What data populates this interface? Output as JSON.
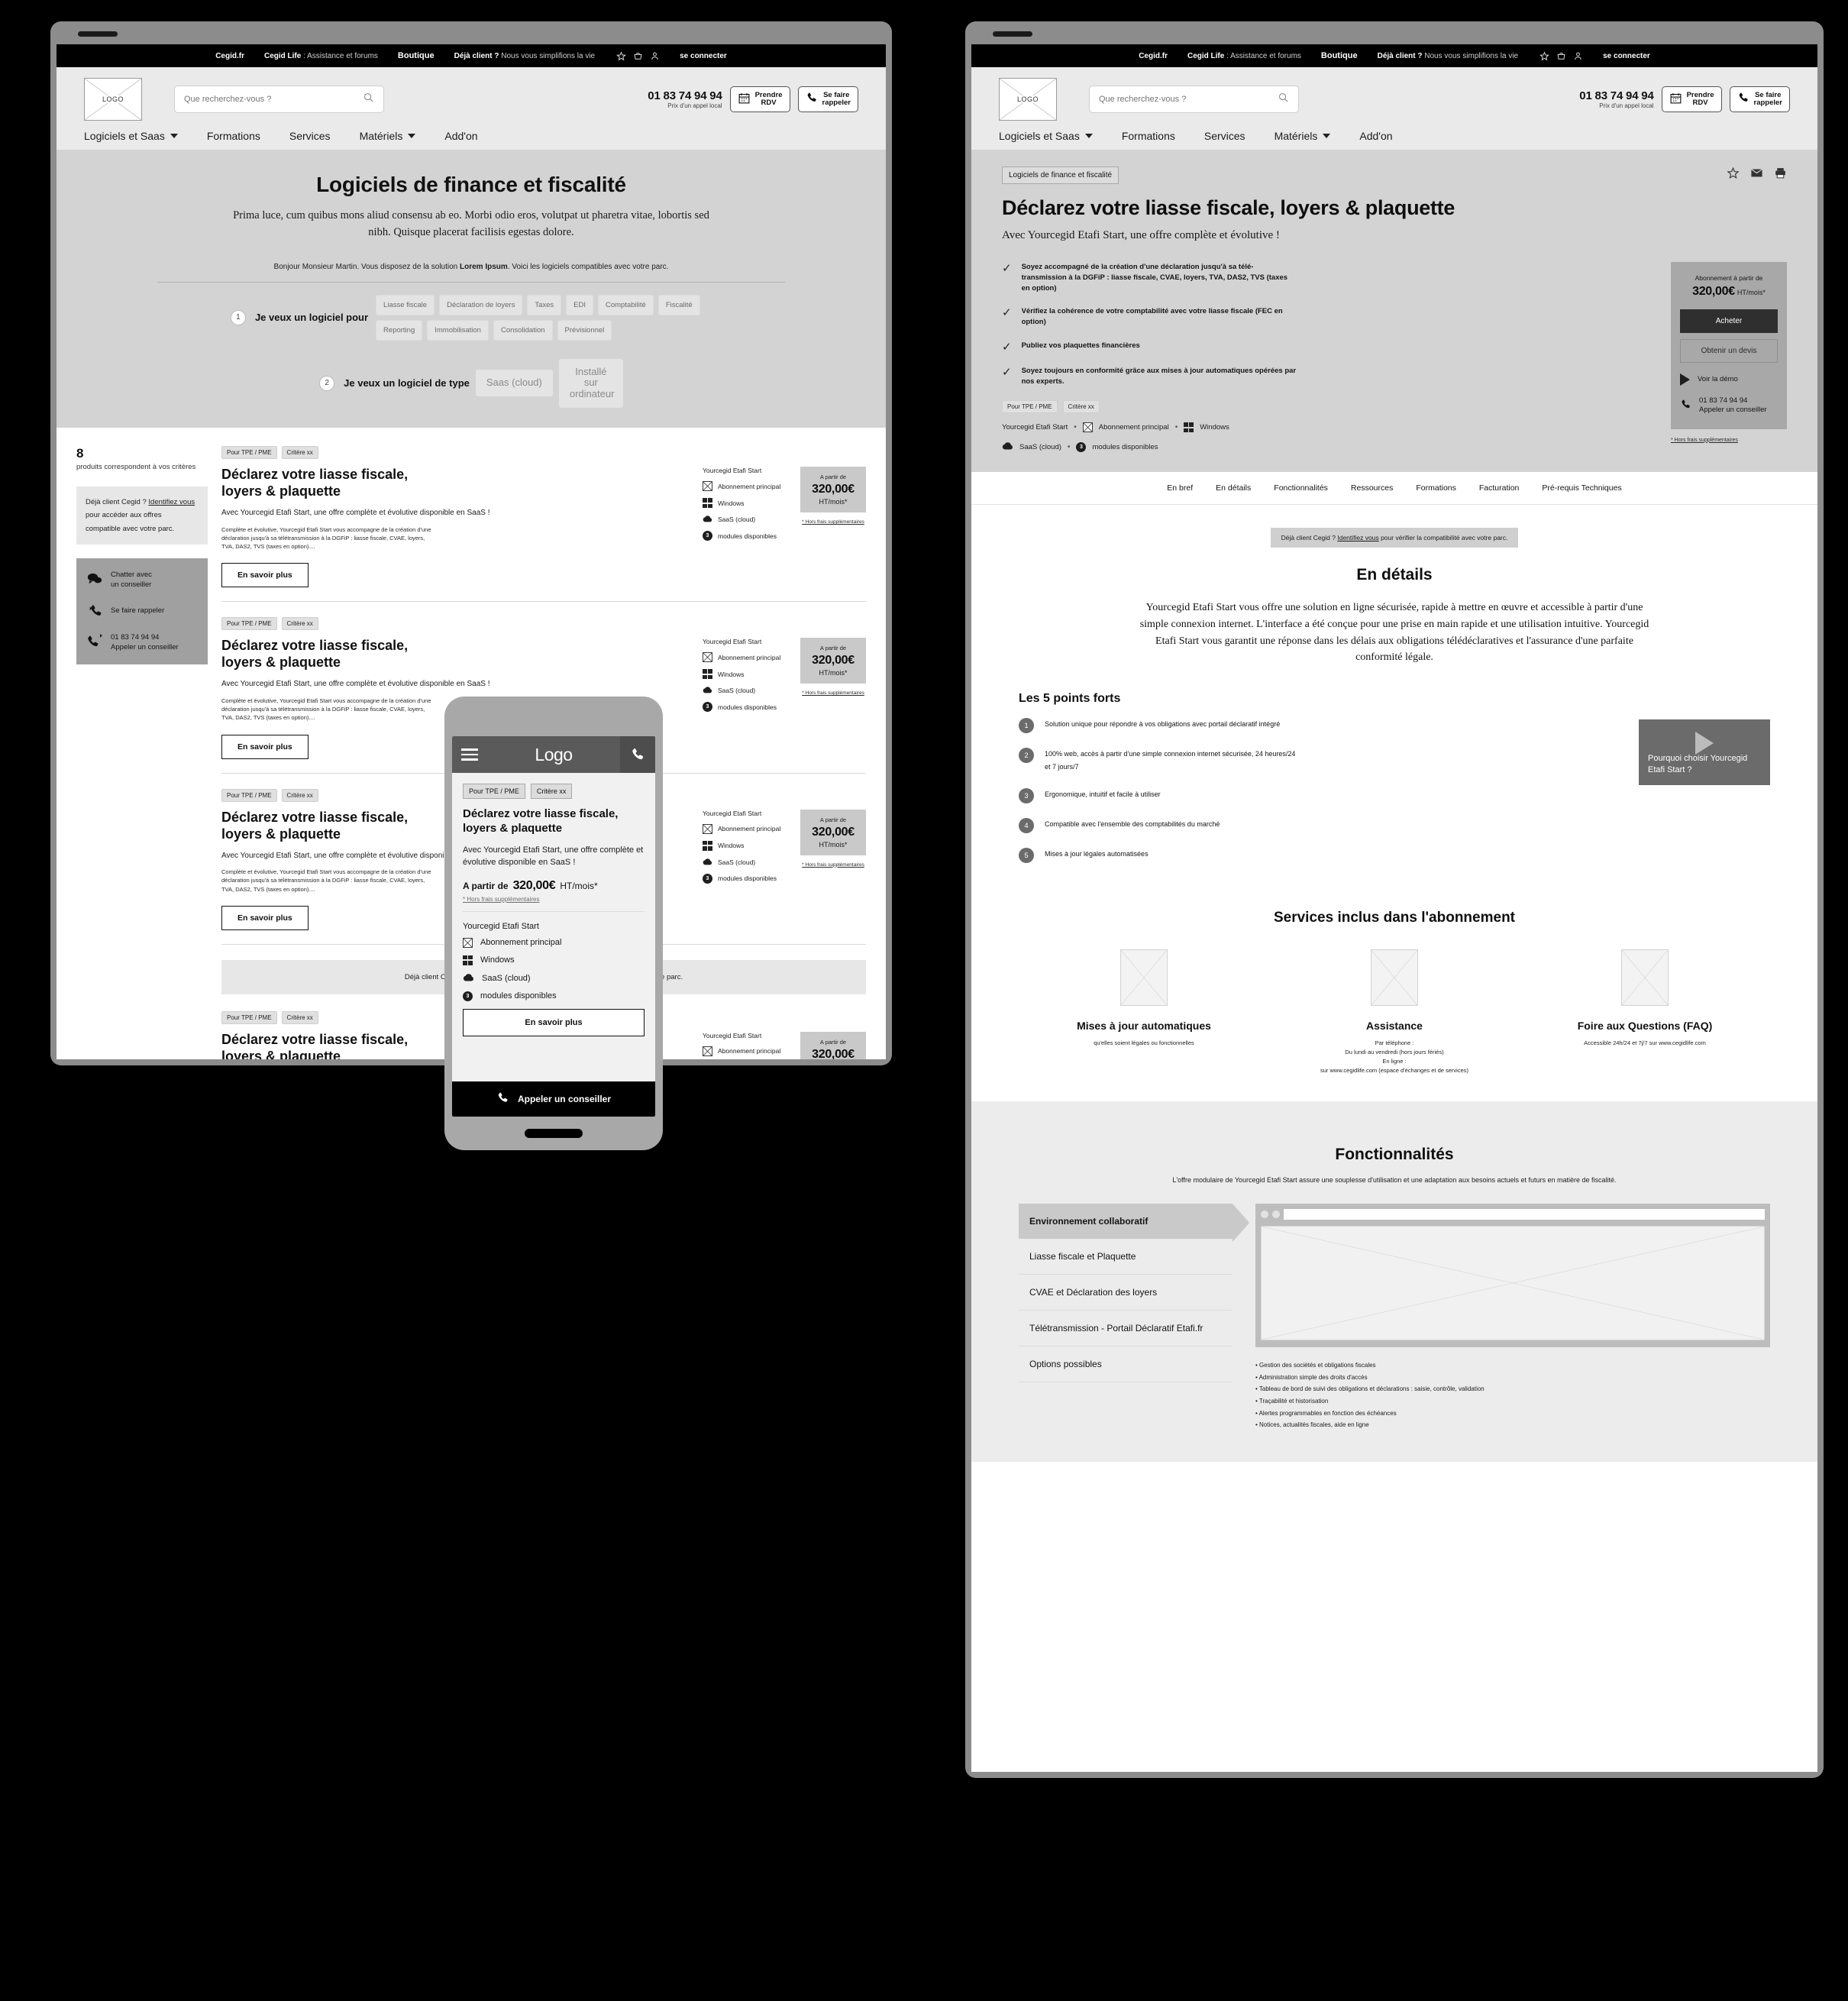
{
  "topbar": {
    "items": [
      {
        "label": "Cegid.fr",
        "bold": true,
        "active": false
      },
      {
        "label": "Cegid Life",
        "suffix": " : Assistance et forums",
        "active": false
      },
      {
        "label": "Boutique",
        "active": true
      },
      {
        "label": "Déjà client ?",
        "suffix": " Nous vous simplifions la vie",
        "active": false
      }
    ],
    "login": "se connecter",
    "icons": [
      "star-icon",
      "basket-icon",
      "user-icon"
    ]
  },
  "header": {
    "logo": "LOGO",
    "search_placeholder": "Que recherchez-vous ?",
    "phone": "01 83 74 94 94",
    "phone_note": "Prix d'un appel local",
    "btn_rdv_l1": "Prendre",
    "btn_rdv_l2": "RDV",
    "btn_call_l1": "Se faire",
    "btn_call_l2": "rappeler",
    "nav": [
      {
        "label": "Logiciels et Saas",
        "caret": true
      },
      {
        "label": "Formations",
        "caret": false
      },
      {
        "label": "Services",
        "caret": false
      },
      {
        "label": "Matériels",
        "caret": true
      },
      {
        "label": "Add'on",
        "caret": false
      }
    ]
  },
  "hero": {
    "title": "Logiciels de finance et fiscalité",
    "lede": "Prima luce, cum quibus mons aliud consensu ab eo. Morbi odio eros, volutpat ut pharetra vitae, lobortis sed nibh. Quisque placerat facilisis egestas dolore.",
    "greet_pre": "Bonjour Monsieur Martin. Vous disposez de la solution ",
    "greet_bold": "Lorem Ipsum",
    "greet_post": ". Voici les logiciels compatibles avec votre parc.",
    "step1_num": "1",
    "step1_label": "Je veux un logiciel pour",
    "step1_chips": [
      "Liasse fiscale",
      "Déclaration de loyers",
      "Taxes",
      "EDI",
      "Comptabilité",
      "Fiscalité",
      "Reporting",
      "Immobilisation",
      "Consolidation",
      "Prévisionnel"
    ],
    "step2_num": "2",
    "step2_label": "Je veux un logiciel de type",
    "step2_options": [
      "Saas (cloud)",
      "Installé sur ordinateur"
    ]
  },
  "results": {
    "count": "8",
    "count_sub": "produits correspondent à vos critères",
    "ident_pre": "Déjà client Cegid ? ",
    "ident_link": "Identifiez vous",
    "ident_post": " pour accéder aux offres compatible avec votre parc.",
    "contact": [
      {
        "icon": "chat-icon",
        "l1": "Chatter avec",
        "l2": "un conseiller"
      },
      {
        "icon": "callback-icon",
        "l1": "Se faire rappeler",
        "l2": ""
      },
      {
        "icon": "phone-out-icon",
        "l1": "01 83 74 94 94",
        "l2": "Appeler un conseiller"
      }
    ],
    "banner_pre": "Déjà client Cegid ? ",
    "banner_link": "Identifiez vous",
    "banner_post": " pour accéder aux offres compatible avec votre parc.",
    "card": {
      "tags": [
        "Pour TPE / PME",
        "Critère xx"
      ],
      "title": "Déclarez votre liasse fiscale, loyers & plaquette",
      "sub": "Avec Yourcegid Etafi Start, une offre complète et évolutive disponible en SaaS !",
      "desc": "Complète et évolutive, Yourcegid Etafi Start vous accompagne de la création d'une déclaration jusqu'à sa télétransmission à la DGFiP : liasse fiscale, CVAE, loyers, TVA, DAS2, TVS (taxes en option)....",
      "cta": "En savoir plus",
      "spec_head": "Yourcegid Etafi Start",
      "specs": [
        {
          "icon": "subscription-icon",
          "label": "Abonnement principal"
        },
        {
          "icon": "windows-icon",
          "label": "Windows"
        },
        {
          "icon": "cloud-icon",
          "label": "SaaS (cloud)"
        },
        {
          "icon": "modules-count-icon",
          "badge": "3",
          "label": "modules disponibles"
        }
      ],
      "price_from": "A partir de",
      "price": "320,00€",
      "price_unit": "HT/mois*",
      "price_note": "* Hors frais  supplémentaires"
    },
    "card_count": 5
  },
  "detail": {
    "breadcrumb": "Logiciels de finance et fiscalité",
    "icons": [
      "star-icon",
      "envelope-icon",
      "printer-icon"
    ],
    "title": "Déclarez votre liasse fiscale, loyers & plaquette",
    "subtitle": "Avec Yourcegid Etafi Start, une offre complète et évolutive !",
    "bullets": [
      "Soyez accompagné de la création d'une déclaration jusqu'à sa télé-transmission à la DGFiP : liasse fiscale, CVAE, loyers, TVA, DAS2, TVS (taxes en option)",
      "Vérifiez la cohérence de votre comptabilité avec votre liasse fiscale (FEC en option)",
      "Publiez vos plaquettes financières",
      "Soyez toujours en conformité grâce aux mises à jour automatiques opérées par nos experts."
    ],
    "tags": [
      "Pour TPE / PME",
      "Critère xx"
    ],
    "meta_line1": [
      "Yourcegid Etafi Start",
      "Abonnement principal",
      "Windows"
    ],
    "meta_line2": [
      "SaaS (cloud)",
      "modules disponibles"
    ],
    "modules_badge": "3",
    "buybox": {
      "label": "Abonnement à partir de",
      "price": "320,00€",
      "unit": "HT/mois*",
      "buy": "Acheter",
      "quote": "Obtenir un devis",
      "demo": "Voir la démo",
      "phone": "01 83 74 94 94",
      "phone_sub": "Appeler un conseiller",
      "note": "* Hors frais supplémentaires"
    },
    "tabs": [
      "En bref",
      "En détails",
      "Fonctionnalités",
      "Ressources",
      "Formations",
      "Facturation",
      "Pré-requis Techniques"
    ],
    "mini_ident_pre": "Déjà client Cegid ? ",
    "mini_ident_link": "Identifiez vous",
    "mini_ident_post": " pour vérifier la compatibilité avec votre parc.",
    "details_h2": "En détails",
    "details_para": "Yourcegid Etafi Start vous offre une solution en ligne sécurisée, rapide à mettre en œuvre et accessible à partir d'une simple connexion internet. L'interface a été conçue pour une prise en main rapide et une utilisation intuitive. Yourcegid Etafi Start vous garantit une réponse dans les délais aux obligations télédéclaratives et l'assurance d'une parfaite conformité légale.",
    "points_h3": "Les 5 points forts",
    "points": [
      "Solution unique pour répondre à vos obligations avec portail déclaratif intégré",
      "100% web, accès à partir d'une simple connexion internet sécurisée, 24 heures/24 et 7 jours/7",
      "Ergonomique, intuitif et facile à utiliser",
      "Compatible avec l'ensemble des comptabilités du marché",
      "Mises à jour légales automatisées"
    ],
    "video_caption": "Pourquoi choisir Yourcegid Etafi Start ?",
    "services_h2": "Services inclus dans l'abonnement",
    "services": [
      {
        "title": "Mises à jour automatiques",
        "sub": "qu'elles soient légales ou fonctionnelles"
      },
      {
        "title": "Assistance",
        "sub": "Par téléphone :\nDu lundi au vendredi (hors jours fériés)\nEn ligne :\nsur www.cegidlife.com (espace d'échanges et de services)"
      },
      {
        "title": "Foire aux Questions (FAQ)",
        "sub": "Accessible 24h/24 et 7j/7 sur www.cegidlife.com"
      }
    ],
    "features_h2": "Fonctionnalités",
    "features_intro": "L'offre modulaire de Yourcegid Etafi Start assure une souplesse d'utilisation et une adaptation aux besoins actuels et futurs en matière de fiscalité.",
    "feature_tabs": [
      "Environnement collaboratif",
      "Liasse fiscale et Plaquette",
      "CVAE et Déclaration des loyers",
      "Télétransmission - Portail Déclaratif Etafi.fr",
      "Options possibles"
    ],
    "feature_bullets": [
      "Gestion des sociétés et obligations fiscales",
      "Administration simple des droits d'accès",
      "Tableau de bord de suivi des obligations et déclarations : saisie, contrôle, validation",
      "Traçabilité et historisation",
      "Alertes programmables en fonction des échéances",
      "Notices, actualités fiscales, aide en ligne"
    ]
  },
  "mobile": {
    "logo": "Logo",
    "tags": [
      "Pour TPE / PME",
      "Critère xx"
    ],
    "title": "Déclarez votre liasse fiscale, loyers & plaquette",
    "sub": "Avec Yourcegid Etafi Start, une offre complète et évolutive disponible en SaaS !",
    "price_label": "A partir de",
    "price": "320,00€",
    "price_unit": "HT/mois*",
    "price_note": "* Hors frais  supplémentaires",
    "spec_head": "Yourcegid Etafi Start",
    "specs": [
      {
        "icon": "subscription-icon",
        "label": "Abonnement principal"
      },
      {
        "icon": "windows-icon",
        "label": "Windows"
      },
      {
        "icon": "cloud-icon",
        "label": "SaaS (cloud)"
      },
      {
        "icon": "modules-count-icon",
        "badge": "3",
        "label": "modules disponibles"
      }
    ],
    "cta": "En savoir plus",
    "bottom_cta": "Appeler un conseiller"
  },
  "colors": {
    "black": "#000000",
    "hero_grey": "#d3d3d3",
    "panel_grey": "#a0a0a0",
    "price_grey": "#c9c9c9"
  }
}
